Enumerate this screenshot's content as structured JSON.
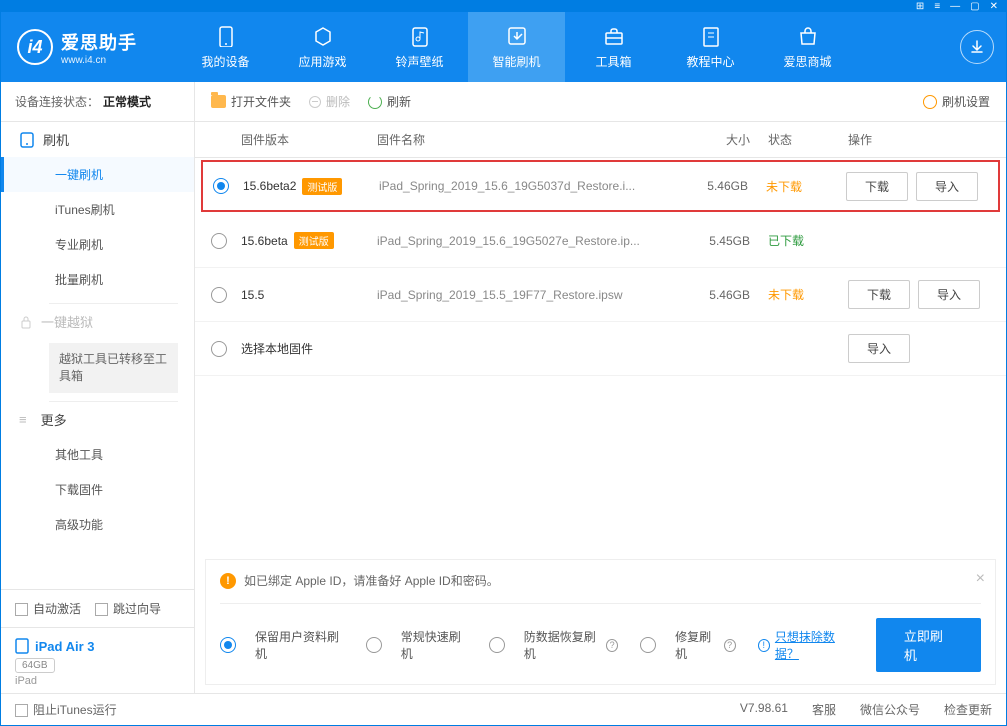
{
  "titlebar": {
    "icons": [
      "⊞",
      "≡",
      "—",
      "▢",
      "✕"
    ]
  },
  "logo": {
    "title": "爱思助手",
    "url": "www.i4.cn"
  },
  "nav": [
    {
      "label": "我的设备",
      "icon": "device"
    },
    {
      "label": "应用游戏",
      "icon": "apps"
    },
    {
      "label": "铃声壁纸",
      "icon": "music"
    },
    {
      "label": "智能刷机",
      "icon": "flash",
      "active": true
    },
    {
      "label": "工具箱",
      "icon": "toolbox"
    },
    {
      "label": "教程中心",
      "icon": "book"
    },
    {
      "label": "爱思商城",
      "icon": "shop"
    }
  ],
  "conn": {
    "label": "设备连接状态：",
    "value": "正常模式"
  },
  "side": {
    "flash_head": "刷机",
    "flash_items": [
      "一键刷机",
      "iTunes刷机",
      "专业刷机",
      "批量刷机"
    ],
    "jailbreak_head": "一键越狱",
    "jailbreak_note": "越狱工具已转移至工具箱",
    "more_head": "更多",
    "more_items": [
      "其他工具",
      "下载固件",
      "高级功能"
    ]
  },
  "side_bottom": {
    "auto": "自动激活",
    "skip": "跳过向导"
  },
  "device": {
    "name": "iPad Air 3",
    "storage": "64GB",
    "type": "iPad"
  },
  "toolbar": {
    "open": "打开文件夹",
    "delete": "删除",
    "refresh": "刷新",
    "settings": "刷机设置"
  },
  "table": {
    "head": {
      "ver": "固件版本",
      "name": "固件名称",
      "size": "大小",
      "status": "状态",
      "ops": "操作"
    }
  },
  "rows": [
    {
      "selected": true,
      "highlight": true,
      "ver": "15.6beta2",
      "beta": "测试版",
      "name": "iPad_Spring_2019_15.6_19G5037d_Restore.i...",
      "size": "5.46GB",
      "status": "未下载",
      "st": "orange",
      "download": true,
      "import": true
    },
    {
      "selected": false,
      "ver": "15.6beta",
      "beta": "测试版",
      "name": "iPad_Spring_2019_15.6_19G5027e_Restore.ip...",
      "size": "5.45GB",
      "status": "已下载",
      "st": "green"
    },
    {
      "selected": false,
      "ver": "15.5",
      "name": "iPad_Spring_2019_15.5_19F77_Restore.ipsw",
      "size": "5.46GB",
      "status": "未下载",
      "st": "orange",
      "download": true,
      "import": true
    },
    {
      "selected": false,
      "local": true,
      "ver_label": "选择本地固件",
      "import": true
    }
  ],
  "btn": {
    "download": "下载",
    "import": "导入"
  },
  "notice": {
    "line1": "如已绑定 Apple ID，请准备好 Apple ID和密码。",
    "opts": [
      "保留用户资料刷机",
      "常规快速刷机",
      "防数据恢复刷机",
      "修复刷机"
    ],
    "erase": "只想抹除数据？",
    "action": "立即刷机"
  },
  "statusbar": {
    "block": "阻止iTunes运行",
    "ver": "V7.98.61",
    "cs": "客服",
    "wechat": "微信公众号",
    "update": "检查更新"
  }
}
